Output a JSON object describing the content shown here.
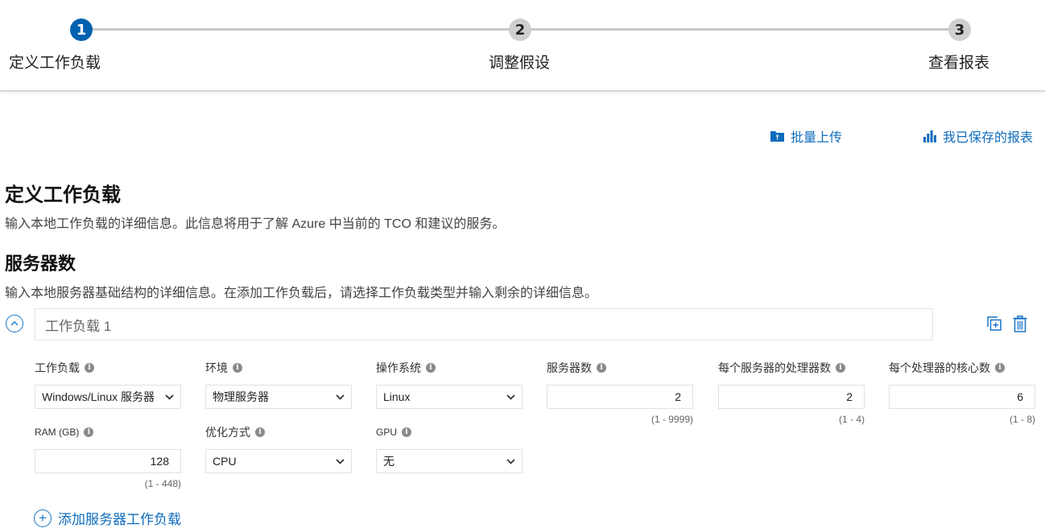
{
  "stepper": {
    "steps": [
      {
        "number": "1",
        "label": "定义工作负载",
        "active": true
      },
      {
        "number": "2",
        "label": "调整假设",
        "active": false
      },
      {
        "number": "3",
        "label": "查看报表",
        "active": false
      }
    ]
  },
  "actions": {
    "bulk_upload": {
      "label": "批量上传",
      "icon": "folder-upload-icon"
    },
    "saved_reports": {
      "label": "我已保存的报表",
      "icon": "bar-chart-icon"
    }
  },
  "page": {
    "title": "定义工作负载",
    "description": "输入本地工作负载的详细信息。此信息将用于了解 Azure 中当前的 TCO 和建议的服务。",
    "servers_title": "服务器数",
    "servers_description": "输入本地服务器基础结构的详细信息。在添加工作负载后，请选择工作负载类型并输入剩余的详细信息。"
  },
  "workload": {
    "name": "工作负载 1",
    "fields": {
      "workload": {
        "label": "工作负载",
        "value": "Windows/Linux 服务器"
      },
      "environment": {
        "label": "环境",
        "value": "物理服务器"
      },
      "os": {
        "label": "操作系统",
        "value": "Linux"
      },
      "servers": {
        "label": "服务器数",
        "value": "2",
        "range": "(1 - 9999)"
      },
      "processors": {
        "label": "每个服务器的处理器数",
        "value": "2",
        "range": "(1 - 4)"
      },
      "cores": {
        "label": "每个处理器的核心数",
        "value": "6",
        "range": "(1 - 8)"
      },
      "ram": {
        "label": "RAM (GB)",
        "value": "128",
        "range": "(1 - 448)"
      },
      "optimize": {
        "label": "优化方式",
        "value": "CPU"
      },
      "gpu": {
        "label": "GPU",
        "value": "无"
      }
    }
  },
  "add_workload": {
    "label": "添加服务器工作负载"
  },
  "colors": {
    "accent": "#0f6cbd",
    "step_active": "#0060b0",
    "step_inactive": "#cfcfcf"
  }
}
